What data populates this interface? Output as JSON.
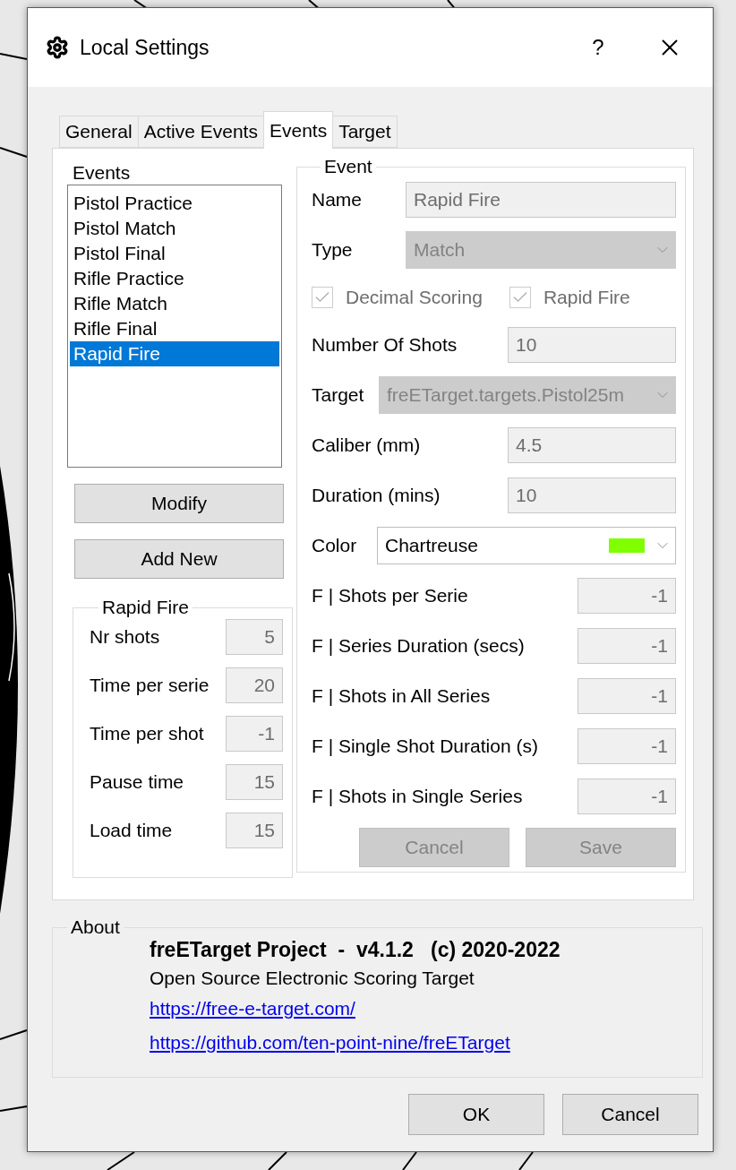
{
  "window": {
    "title": "Local Settings",
    "help": "?"
  },
  "tabs": [
    {
      "label": "General",
      "selected": false
    },
    {
      "label": "Active Events",
      "selected": false
    },
    {
      "label": "Events",
      "selected": true
    },
    {
      "label": "Target",
      "selected": false
    }
  ],
  "events_list": {
    "label": "Events",
    "items": [
      {
        "name": "Pistol Practice",
        "selected": false
      },
      {
        "name": "Pistol Match",
        "selected": false
      },
      {
        "name": "Pistol Final",
        "selected": false
      },
      {
        "name": "Rifle Practice",
        "selected": false
      },
      {
        "name": "Rifle Match",
        "selected": false
      },
      {
        "name": "Rifle Final",
        "selected": false
      },
      {
        "name": "Rapid Fire",
        "selected": true
      }
    ]
  },
  "list_buttons": [
    "Modify",
    "Add New"
  ],
  "rapid_fire": {
    "title": "Rapid Fire",
    "fields": [
      {
        "label": "Nr shots",
        "value": "5"
      },
      {
        "label": "Time per serie",
        "value": "20"
      },
      {
        "label": "Time per shot",
        "value": "-1"
      },
      {
        "label": "Pause time",
        "value": "15"
      },
      {
        "label": "Load time",
        "value": "15"
      }
    ]
  },
  "event": {
    "title": "Event",
    "disabled": true,
    "name": {
      "label": "Name",
      "value": "Rapid Fire"
    },
    "type": {
      "label": "Type",
      "value": "Match"
    },
    "checkboxes": [
      {
        "label": "Decimal Scoring",
        "checked": true
      },
      {
        "label": "Rapid Fire",
        "checked": true
      }
    ],
    "number_of_shots": {
      "label": "Number Of Shots",
      "value": "10"
    },
    "target": {
      "label": "Target",
      "value": "freETarget.targets.Pistol25m"
    },
    "caliber": {
      "label": "Caliber (mm)",
      "value": "4.5"
    },
    "duration": {
      "label": "Duration (mins)",
      "value": "10"
    },
    "color": {
      "label": "Color",
      "value": "Chartreuse",
      "color": "#7fff00"
    },
    "final_fields": [
      {
        "label": "F | Shots per Serie",
        "value": "-1"
      },
      {
        "label": "F | Series Duration (secs)",
        "value": "-1"
      },
      {
        "label": "F | Shots in All Series",
        "value": "-1"
      },
      {
        "label": "F | Single Shot Duration (s)",
        "value": "-1"
      },
      {
        "label": "F | Shots in Single Series",
        "value": "-1"
      }
    ],
    "buttons": [
      "Cancel",
      "Save"
    ]
  },
  "about": {
    "title": "About",
    "heading": "freETarget Project  -  v4.1.2   (c) 2020-2022",
    "description": "Open Source Electronic Scoring Target",
    "links": [
      "https://free-e-target.com/",
      "https://github.com/ten-point-nine/freETarget"
    ]
  },
  "footer_buttons": [
    "OK",
    "Cancel"
  ]
}
